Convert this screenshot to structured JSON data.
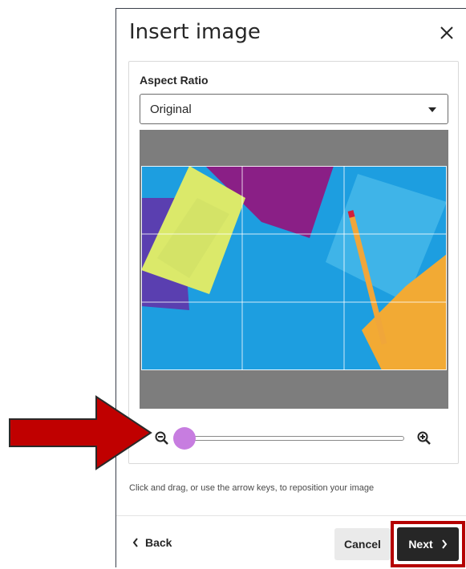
{
  "dialog": {
    "title": "Insert image",
    "close_icon": "close-icon"
  },
  "aspect_ratio": {
    "label": "Aspect Ratio",
    "selected": "Original"
  },
  "zoom": {
    "zoom_out_icon": "zoom-out-icon",
    "zoom_in_icon": "zoom-in-icon",
    "level": 0
  },
  "hint": "Click and drag, or use the arrow keys, to reposition your image",
  "footer": {
    "back_label": "Back",
    "cancel_label": "Cancel",
    "next_label": "Next"
  },
  "colors": {
    "slider_thumb": "#c77de0",
    "highlight": "#b50000",
    "arrow": "#c00000",
    "primary_button": "#262626"
  }
}
